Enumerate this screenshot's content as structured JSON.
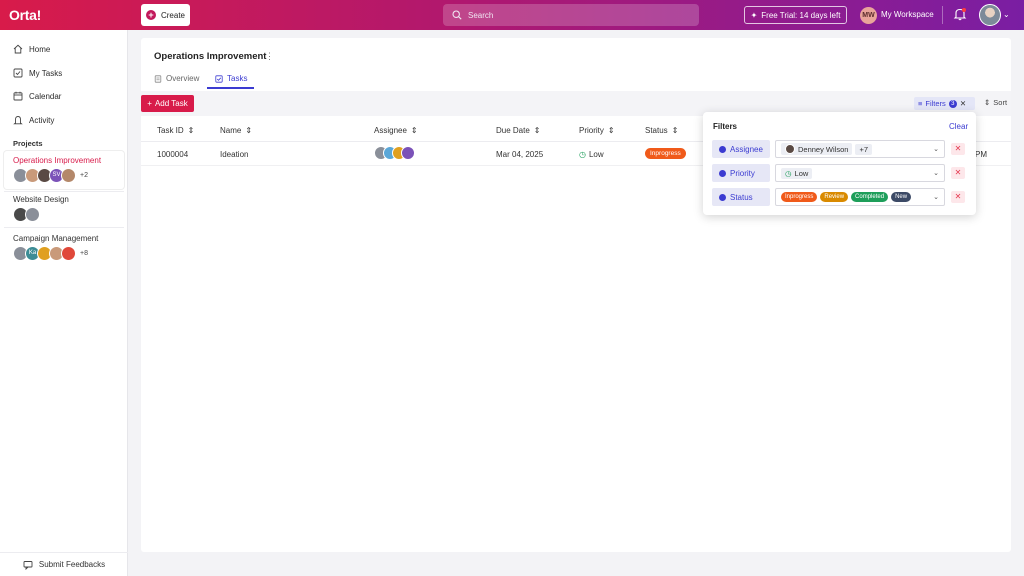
{
  "app": {
    "logo": "Orta!",
    "create_label": "Create",
    "search_placeholder": "Search",
    "trial_label": "Free Trial: 14 days left",
    "workspace_initials": "MW",
    "workspace_name": "My Workspace"
  },
  "sidebar": {
    "nav": [
      {
        "label": "Home",
        "icon": "home-icon"
      },
      {
        "label": "My Tasks",
        "icon": "checkbox-icon"
      },
      {
        "label": "Calendar",
        "icon": "calendar-icon"
      },
      {
        "label": "Activity",
        "icon": "activity-icon"
      }
    ],
    "projects_heading": "Projects",
    "projects": [
      {
        "name": "Operations Improvement",
        "active": true,
        "avatars": [
          "",
          "",
          "",
          "SV",
          ""
        ],
        "more": "+2"
      },
      {
        "name": "Website Design",
        "active": false,
        "avatars": [
          "",
          ""
        ],
        "more": ""
      },
      {
        "name": "Campaign Management",
        "active": false,
        "avatars": [
          "",
          "Ka",
          "",
          "",
          ""
        ],
        "more": "+8"
      }
    ],
    "feedback_label": "Submit Feedbacks"
  },
  "main": {
    "title": "Operations Improvement",
    "tabs": [
      {
        "label": "Overview",
        "active": false
      },
      {
        "label": "Tasks",
        "active": true
      }
    ],
    "add_task_label": "Add Task",
    "filters_label": "Filters",
    "filters_count": "3",
    "sort_label": "Sort",
    "table": {
      "columns": [
        "Task ID",
        "Name",
        "Assignee",
        "Due Date",
        "Priority",
        "Status"
      ],
      "rows": [
        {
          "id": "1000004",
          "name": "Ideation",
          "due": "Mar 04, 2025",
          "priority": "Low",
          "status": "Inprogress",
          "trailing": "PM"
        }
      ]
    }
  },
  "filter_popup": {
    "title": "Filters",
    "clear_label": "Clear",
    "rows": [
      {
        "label": "Assignee",
        "value": "Denney Wilson",
        "more": "+7"
      },
      {
        "label": "Priority",
        "value": "Low"
      },
      {
        "label": "Status",
        "values": [
          "Inprogress",
          "Review",
          "Completed",
          "New"
        ]
      }
    ]
  },
  "colors": {
    "brand": "#d81b4a",
    "accent": "#3b3bd1",
    "inprogress": "#f05a1a",
    "review": "#d98a00",
    "completed": "#1e9e5a",
    "new": "#3c4a66"
  }
}
